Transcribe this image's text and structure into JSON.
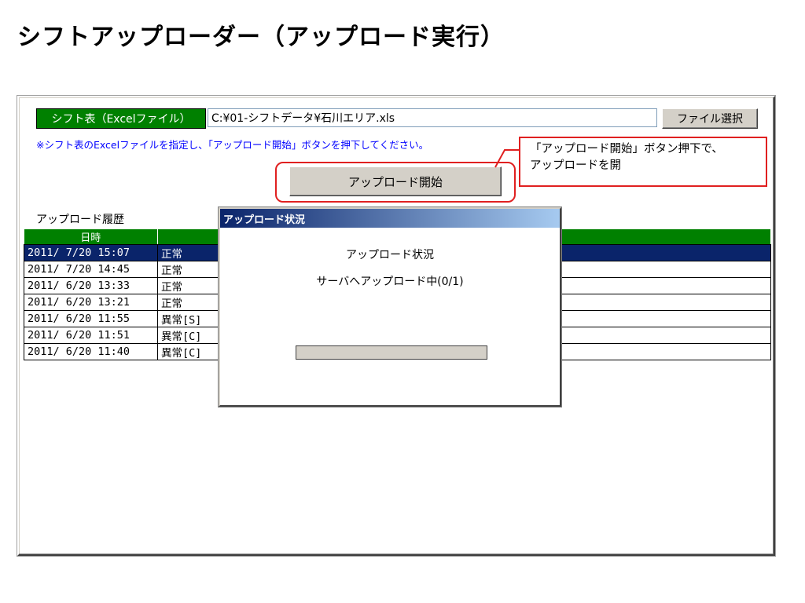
{
  "page": {
    "title": "シフトアップローダー（アップロード実行）"
  },
  "form": {
    "file_label": "シフト表（Excelファイル）",
    "file_path": "C:¥01-シフトデータ¥石川エリア.xls",
    "select_button": "ファイル選択",
    "instruction": "※シフト表のExcelファイルを指定し、「アップロード開始」ボタンを押下してください。",
    "upload_button": "アップロード開始"
  },
  "history": {
    "label": "アップロード履歴",
    "columns": [
      "日時",
      ""
    ],
    "rows": [
      {
        "datetime": "2011/ 7/20 15:07",
        "status": "正常",
        "selected": true
      },
      {
        "datetime": "2011/ 7/20 14:45",
        "status": "正常",
        "selected": false
      },
      {
        "datetime": "2011/ 6/20 13:33",
        "status": "正常",
        "selected": false
      },
      {
        "datetime": "2011/ 6/20 13:21",
        "status": "正常",
        "selected": false
      },
      {
        "datetime": "2011/ 6/20 11:55",
        "status": "異常[S]",
        "selected": false
      },
      {
        "datetime": "2011/ 6/20 11:51",
        "status": "異常[C]",
        "selected": false
      },
      {
        "datetime": "2011/ 6/20 11:40",
        "status": "異常[C]",
        "selected": false
      }
    ]
  },
  "callout": {
    "line1": "「アップロード開始」ボタン押下で、",
    "line2": "アップロードを開"
  },
  "dialog": {
    "title": "アップロード状況",
    "status_heading": "アップロード状況",
    "status_detail": "サーバへアップロード中(0/1)",
    "progress": 0
  },
  "colors": {
    "header_green": "#008000",
    "selection_blue": "#0a246a",
    "instruction_blue": "#0000ff",
    "annotation_red": "#e02020"
  }
}
